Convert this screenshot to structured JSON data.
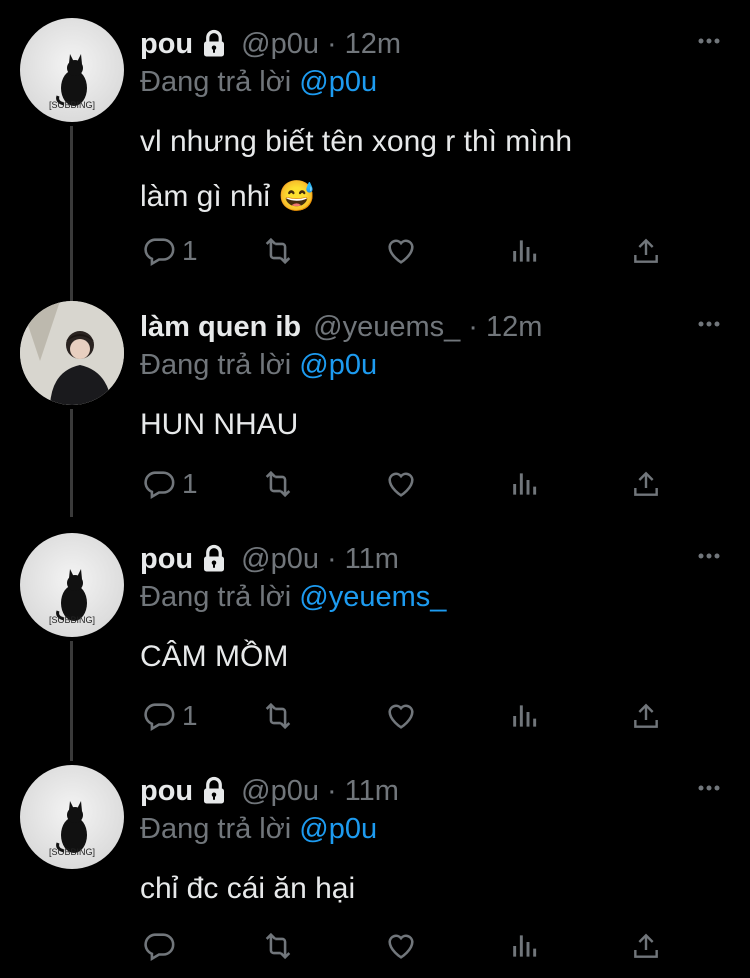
{
  "tweets": [
    {
      "name": "pou",
      "locked": true,
      "handle": "@p0u",
      "sep": "·",
      "time": "12m",
      "reply_prefix": "Đang trả lời",
      "reply_to": "@p0u",
      "text_lines": [
        "vl nhưng biết tên xong r thì mình",
        "làm gì nhỉ 😅"
      ],
      "reply_count": "1",
      "avatar_caption": "[SOBBING]"
    },
    {
      "name": "làm quen ib",
      "locked": false,
      "handle": "@yeuems_",
      "sep": "·",
      "time": "12m",
      "reply_prefix": "Đang trả lời",
      "reply_to": "@p0u",
      "text_lines": [
        "HUN NHAU"
      ],
      "reply_count": "1",
      "avatar_caption": ""
    },
    {
      "name": "pou",
      "locked": true,
      "handle": "@p0u",
      "sep": "·",
      "time": "11m",
      "reply_prefix": "Đang trả lời",
      "reply_to": "@yeuems_",
      "text_lines": [
        "CÂM MỒM"
      ],
      "reply_count": "1",
      "avatar_caption": "[SOBBING]"
    },
    {
      "name": "pou",
      "locked": true,
      "handle": "@p0u",
      "sep": "·",
      "time": "11m",
      "reply_prefix": "Đang trả lời",
      "reply_to": "@p0u",
      "text_lines": [
        "chỉ đc cái ăn hại"
      ],
      "reply_count": "",
      "avatar_caption": "[SOBBING]"
    }
  ],
  "icons": [
    "lock-icon",
    "more-icon",
    "reply-icon",
    "retweet-icon",
    "like-icon",
    "views-icon",
    "share-icon"
  ],
  "colors": {
    "background": "#000000",
    "text": "#e7e9ea",
    "muted": "#71767b",
    "link": "#1d9bf0"
  }
}
